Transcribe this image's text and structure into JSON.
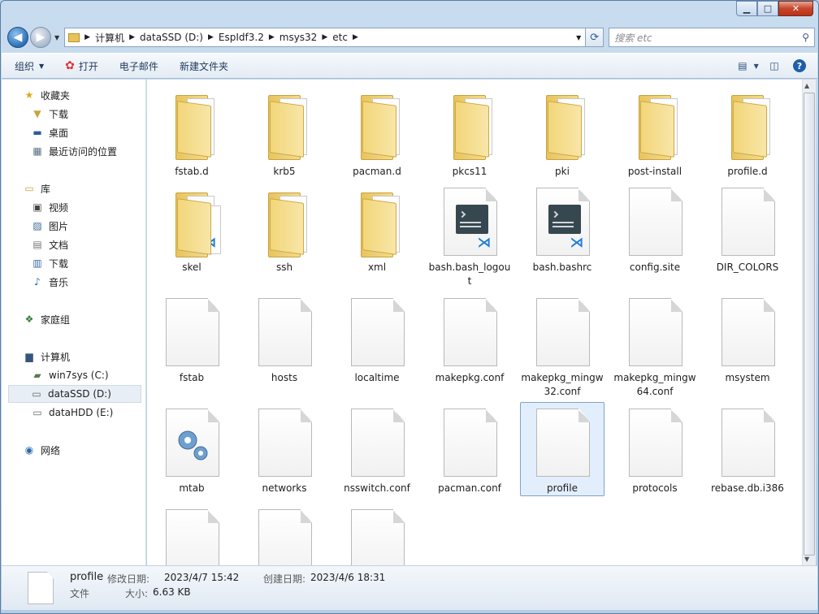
{
  "breadcrumb": [
    "计算机",
    "dataSSD (D:)",
    "EspIdf3.2",
    "msys32",
    "etc"
  ],
  "search": {
    "placeholder": "搜索 etc"
  },
  "toolbar": {
    "organize": "组织",
    "open": "打开",
    "email": "电子邮件",
    "new_folder": "新建文件夹"
  },
  "sidebar": {
    "favorites": "收藏夹",
    "fav_items": [
      "下载",
      "桌面",
      "最近访问的位置"
    ],
    "libraries": "库",
    "lib_items": [
      "视频",
      "图片",
      "文档",
      "下载",
      "音乐"
    ],
    "homegroup": "家庭组",
    "computer": "计算机",
    "drives": [
      "win7sys (C:)",
      "dataSSD (D:)",
      "dataHDD (E:)"
    ],
    "network": "网络"
  },
  "files": [
    {
      "name": "fstab.d",
      "type": "folder"
    },
    {
      "name": "krb5",
      "type": "folder"
    },
    {
      "name": "pacman.d",
      "type": "folder"
    },
    {
      "name": "pkcs11",
      "type": "folder"
    },
    {
      "name": "pki",
      "type": "folder"
    },
    {
      "name": "post-install",
      "type": "folder"
    },
    {
      "name": "profile.d",
      "type": "folder"
    },
    {
      "name": "skel",
      "type": "folder-vs"
    },
    {
      "name": "ssh",
      "type": "folder"
    },
    {
      "name": "xml",
      "type": "folder"
    },
    {
      "name": "bash.bash_logout",
      "type": "vscode"
    },
    {
      "name": "bash.bashrc",
      "type": "vscode"
    },
    {
      "name": "config.site",
      "type": "doc"
    },
    {
      "name": "DIR_COLORS",
      "type": "doc"
    },
    {
      "name": "fstab",
      "type": "doc"
    },
    {
      "name": "hosts",
      "type": "doc"
    },
    {
      "name": "localtime",
      "type": "doc"
    },
    {
      "name": "makepkg.conf",
      "type": "doc"
    },
    {
      "name": "makepkg_mingw32.conf",
      "type": "doc"
    },
    {
      "name": "makepkg_mingw64.conf",
      "type": "doc"
    },
    {
      "name": "msystem",
      "type": "doc"
    },
    {
      "name": "mtab",
      "type": "gear"
    },
    {
      "name": "networks",
      "type": "doc"
    },
    {
      "name": "nsswitch.conf",
      "type": "doc"
    },
    {
      "name": "pacman.conf",
      "type": "doc"
    },
    {
      "name": "profile",
      "type": "doc",
      "selected": true
    },
    {
      "name": "protocols",
      "type": "doc"
    },
    {
      "name": "rebase.db.i386",
      "type": "doc"
    },
    {
      "name": "",
      "type": "doc"
    },
    {
      "name": "",
      "type": "doc"
    },
    {
      "name": "",
      "type": "doc"
    }
  ],
  "status": {
    "name": "profile",
    "modified_label": "修改日期:",
    "modified": "2023/4/7 15:42",
    "created_label": "创建日期:",
    "created": "2023/4/6 18:31",
    "type": "文件",
    "size_label": "大小:",
    "size": "6.63 KB"
  }
}
